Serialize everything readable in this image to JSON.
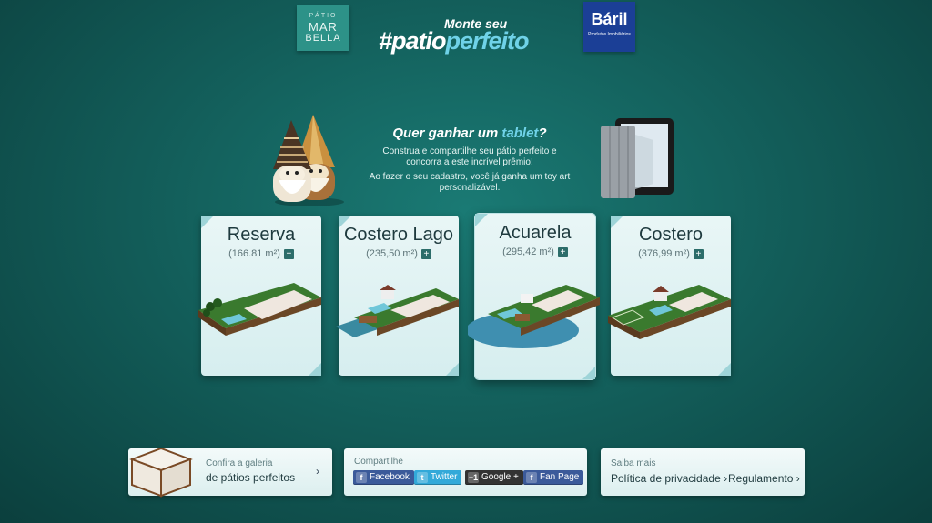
{
  "header": {
    "left_logo": {
      "pre": "PÁTIO",
      "main": "MAR",
      "sub": "BELLA"
    },
    "headline": {
      "top": "Monte seu",
      "hash": "#patio",
      "accent": "perfeito"
    },
    "right_logo": {
      "name": "Báril",
      "tagline": "Produtos Imobiliários"
    }
  },
  "promo": {
    "title_start": "Quer ganhar um ",
    "title_highlight": "tablet",
    "title_end": "?",
    "line1": "Construa e compartilhe seu pátio perfeito e concorra a este incrível prêmio!",
    "line2": "Ao fazer o seu cadastro, você já ganha um toy art personalizável."
  },
  "cards": [
    {
      "name": "Reserva",
      "area": "(166.81 m²)",
      "plus": "+"
    },
    {
      "name": "Costero Lago",
      "area": "(235,50 m²)",
      "plus": "+"
    },
    {
      "name": "Acuarela",
      "area": "(295,42 m²)",
      "plus": "+"
    },
    {
      "name": "Costero",
      "area": "(376,99 m²)",
      "plus": "+"
    }
  ],
  "footer": {
    "gallery": {
      "line1": "Confira a galeria",
      "line2": "de pátios perfeitos",
      "chevron": "›"
    },
    "share": {
      "title": "Compartilhe",
      "buttons": [
        {
          "icon": "f",
          "label": "Facebook"
        },
        {
          "icon": "t",
          "label": "Twitter"
        },
        {
          "icon": "+1",
          "label": "Google +"
        },
        {
          "icon": "f",
          "label": "Fan Page"
        }
      ]
    },
    "more": {
      "title": "Saiba mais",
      "privacy": "Política de privacidade ›",
      "rules": "Regulamento ›"
    }
  },
  "colors": {
    "background": "#135f5b",
    "accent": "#6fd2e8",
    "facebook": "#3b5a9a",
    "twitter": "#32a9d9",
    "google": "#333333"
  }
}
